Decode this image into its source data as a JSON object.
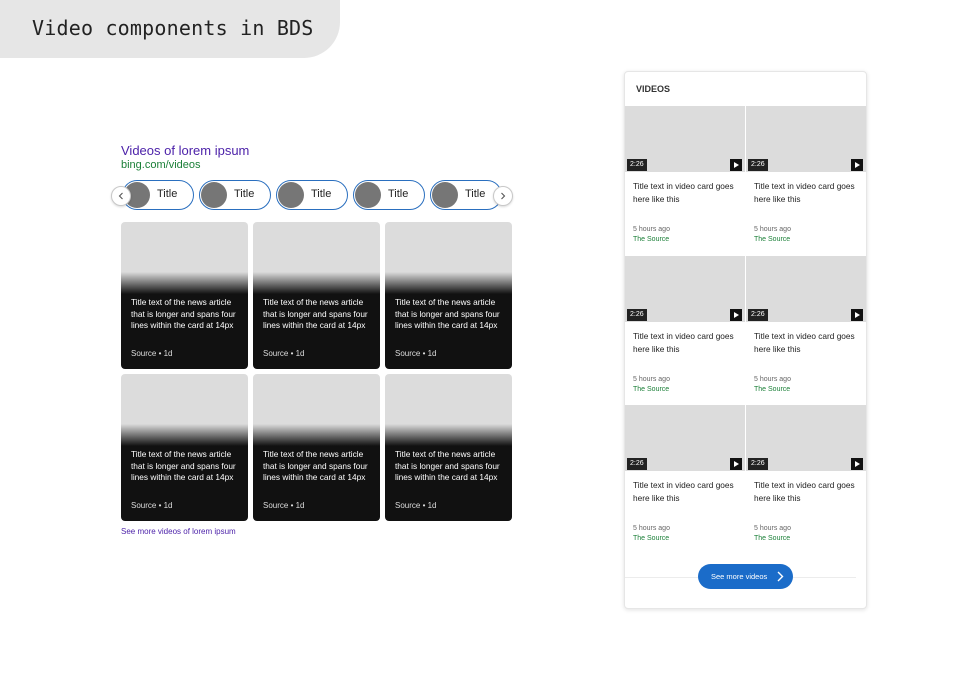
{
  "header": {
    "title": "Video components in BDS"
  },
  "left": {
    "title": "Videos of lorem ipsum",
    "url": "bing.com/videos",
    "pills": [
      "Title",
      "Title",
      "Title",
      "Title",
      "Title"
    ],
    "cards": [
      {
        "title": "Title text of the news article that is longer and spans four lines within the card at 14px",
        "source": "Source • 1d"
      },
      {
        "title": "Title text of the news article that is longer and spans four lines within the card at 14px",
        "source": "Source • 1d"
      },
      {
        "title": "Title text of the news article that is longer and spans four lines within the card at 14px",
        "source": "Source • 1d"
      },
      {
        "title": "Title text of the news article that is longer and spans four lines within the card at 14px",
        "source": "Source • 1d"
      },
      {
        "title": "Title text of the news article that is longer and spans four lines within the card at 14px",
        "source": "Source • 1d"
      },
      {
        "title": "Title text of the news article that is longer and spans four lines within the card at 14px",
        "source": "Source • 1d"
      }
    ],
    "see_more": "See more videos of lorem ipsum"
  },
  "panel": {
    "header": "VIDEOS",
    "videos": [
      {
        "duration": "2:26",
        "title": "Title text in video card goes here like this",
        "time": "5 hours ago",
        "source": "The Source"
      },
      {
        "duration": "2:26",
        "title": "Title text in video card goes here like this",
        "time": "5 hours ago",
        "source": "The Source"
      },
      {
        "duration": "2:26",
        "title": "Title text in video card goes here like this",
        "time": "5 hours ago",
        "source": "The Source"
      },
      {
        "duration": "2:26",
        "title": "Title text in video card goes here like this",
        "time": "5 hours ago",
        "source": "The Source"
      },
      {
        "duration": "2:26",
        "title": "Title text in video card goes here like this",
        "time": "5 hours ago",
        "source": "The Source"
      },
      {
        "duration": "2:26",
        "title": "Title text in video card goes here like this",
        "time": "5 hours ago",
        "source": "The Source"
      }
    ],
    "button": "See more videos"
  },
  "icons": {
    "prev": "chevron-left-icon",
    "next": "chevron-right-icon",
    "play": "play-icon"
  },
  "colors": {
    "link": "#4a1fa8",
    "url": "#1a7f37",
    "button": "#1b6cc9",
    "pill_border": "#2a6fbf"
  }
}
